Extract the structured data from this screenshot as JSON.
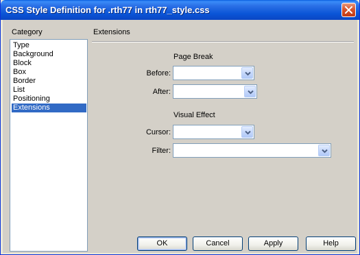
{
  "window": {
    "title": "CSS Style Definition for .rth77 in rth77_style.css"
  },
  "category": {
    "label": "Category",
    "items": [
      "Type",
      "Background",
      "Block",
      "Box",
      "Border",
      "List",
      "Positioning",
      "Extensions"
    ],
    "selected": "Extensions"
  },
  "panel": {
    "title": "Extensions",
    "page_break": {
      "heading": "Page Break",
      "before_label": "Before:",
      "before_value": "",
      "after_label": "After:",
      "after_value": ""
    },
    "visual_effect": {
      "heading": "Visual Effect",
      "cursor_label": "Cursor:",
      "cursor_value": "",
      "filter_label": "Filter:",
      "filter_value": ""
    }
  },
  "buttons": {
    "ok": "OK",
    "cancel": "Cancel",
    "apply": "Apply",
    "help": "Help"
  },
  "colors": {
    "titlebar": "#0a54d6",
    "selection": "#316ac5",
    "dialog_bg": "#d4d0c8"
  }
}
